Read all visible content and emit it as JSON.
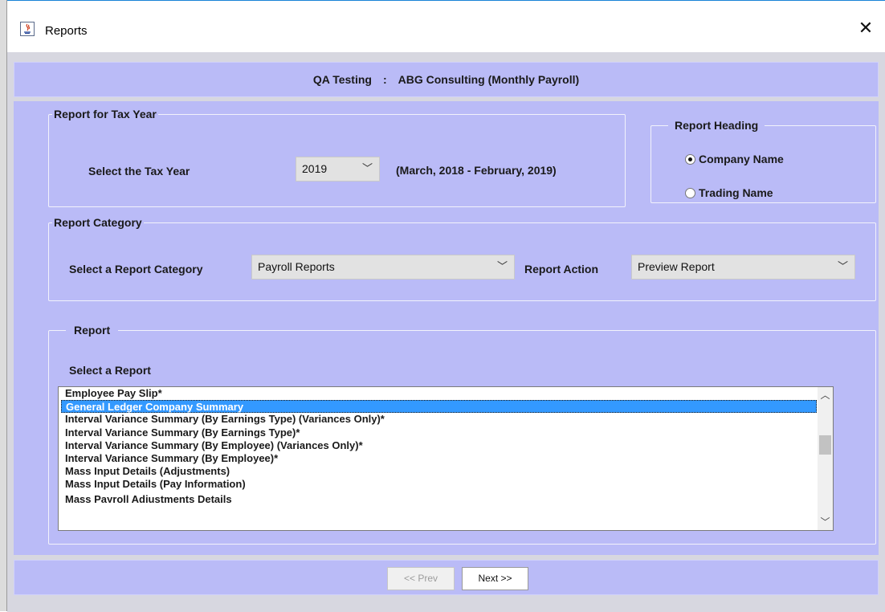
{
  "window": {
    "title": "Reports",
    "close_glyph": "✕",
    "icon": "java-app-icon"
  },
  "header": {
    "org": "QA Testing",
    "separator": ":",
    "company": "ABG Consulting (Monthly Payroll)"
  },
  "tax_year": {
    "legend": "Report for Tax Year",
    "label": "Select the Tax Year",
    "selected": "2019",
    "range": "(March, 2018 - February, 2019)"
  },
  "report_heading": {
    "legend": "Report Heading",
    "options": [
      {
        "label": "Company Name",
        "selected": true
      },
      {
        "label": "Trading Name",
        "selected": false
      }
    ]
  },
  "category": {
    "legend": "Report Category",
    "label": "Select a Report Category",
    "selected": "Payroll Reports",
    "action_label": "Report Action",
    "action_selected": "Preview Report"
  },
  "report": {
    "legend": "Report",
    "label": "Select a Report",
    "items": [
      "Employee Pay Slip*",
      "General Ledger Company Summary",
      "Interval Variance Summary (By Earnings Type) (Variances Only)*",
      "Interval Variance Summary (By Earnings Type)*",
      "Interval Variance Summary (By Employee) (Variances Only)*",
      "Interval Variance Summary (By Employee)*",
      "Mass Input Details (Adjustments)",
      "Mass Input Details (Pay Information)",
      "Mass Payroll Adjustments Details"
    ],
    "selected_index": 1
  },
  "footer": {
    "prev_label": "<< Prev",
    "next_label": "Next >>"
  },
  "glyphs": {
    "chevron_down": "﹀",
    "scroll_up": "︿",
    "scroll_down": "﹀"
  },
  "colors": {
    "panel": "#babbf7",
    "client": "#d7d7e0",
    "selection": "#3399ff"
  }
}
